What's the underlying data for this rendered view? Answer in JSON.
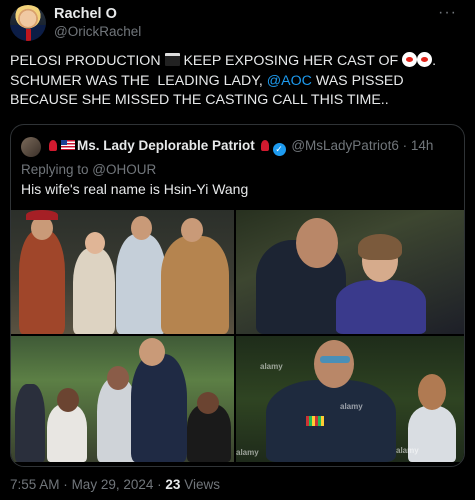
{
  "post": {
    "display_name": "Rachel O",
    "handle": "@OrickRachel",
    "text_part1": "PELOSI PRODUCTION ",
    "text_part2": " KEEP EXPOSING HER CAST OF ",
    "text_part3": ". SCHUMER WAS THE  LEADING LADY, ",
    "mention": "@AOC",
    "text_part4": " WAS PISSED BECAUSE SHE MISSED THE CASTING CALL THIS TIME..",
    "more_icon": "ellipsis-icon"
  },
  "quoted": {
    "display_name": "Ms. Lady Deplorable Patriot",
    "handle": "@MsLadyPatriot6",
    "separator": "·",
    "time": "14h",
    "replying_prefix": "Replying to ",
    "replying_to": "@OHOUR",
    "text": "His wife's real name is Hsin-Yi Wang",
    "photos": [
      "photo-group-party",
      "photo-embrace",
      "photo-ceremony-crowd",
      "photo-military-officer"
    ],
    "watermark": "alamy"
  },
  "footer": {
    "time": "7:55 AM",
    "separator": "·",
    "date": "May 29, 2024",
    "views_count": "23",
    "views_label": "Views"
  },
  "colors": {
    "background": "#000000",
    "text": "#e7e9ea",
    "muted": "#71767b",
    "accent": "#1d9bf0",
    "border": "#2f3336"
  }
}
